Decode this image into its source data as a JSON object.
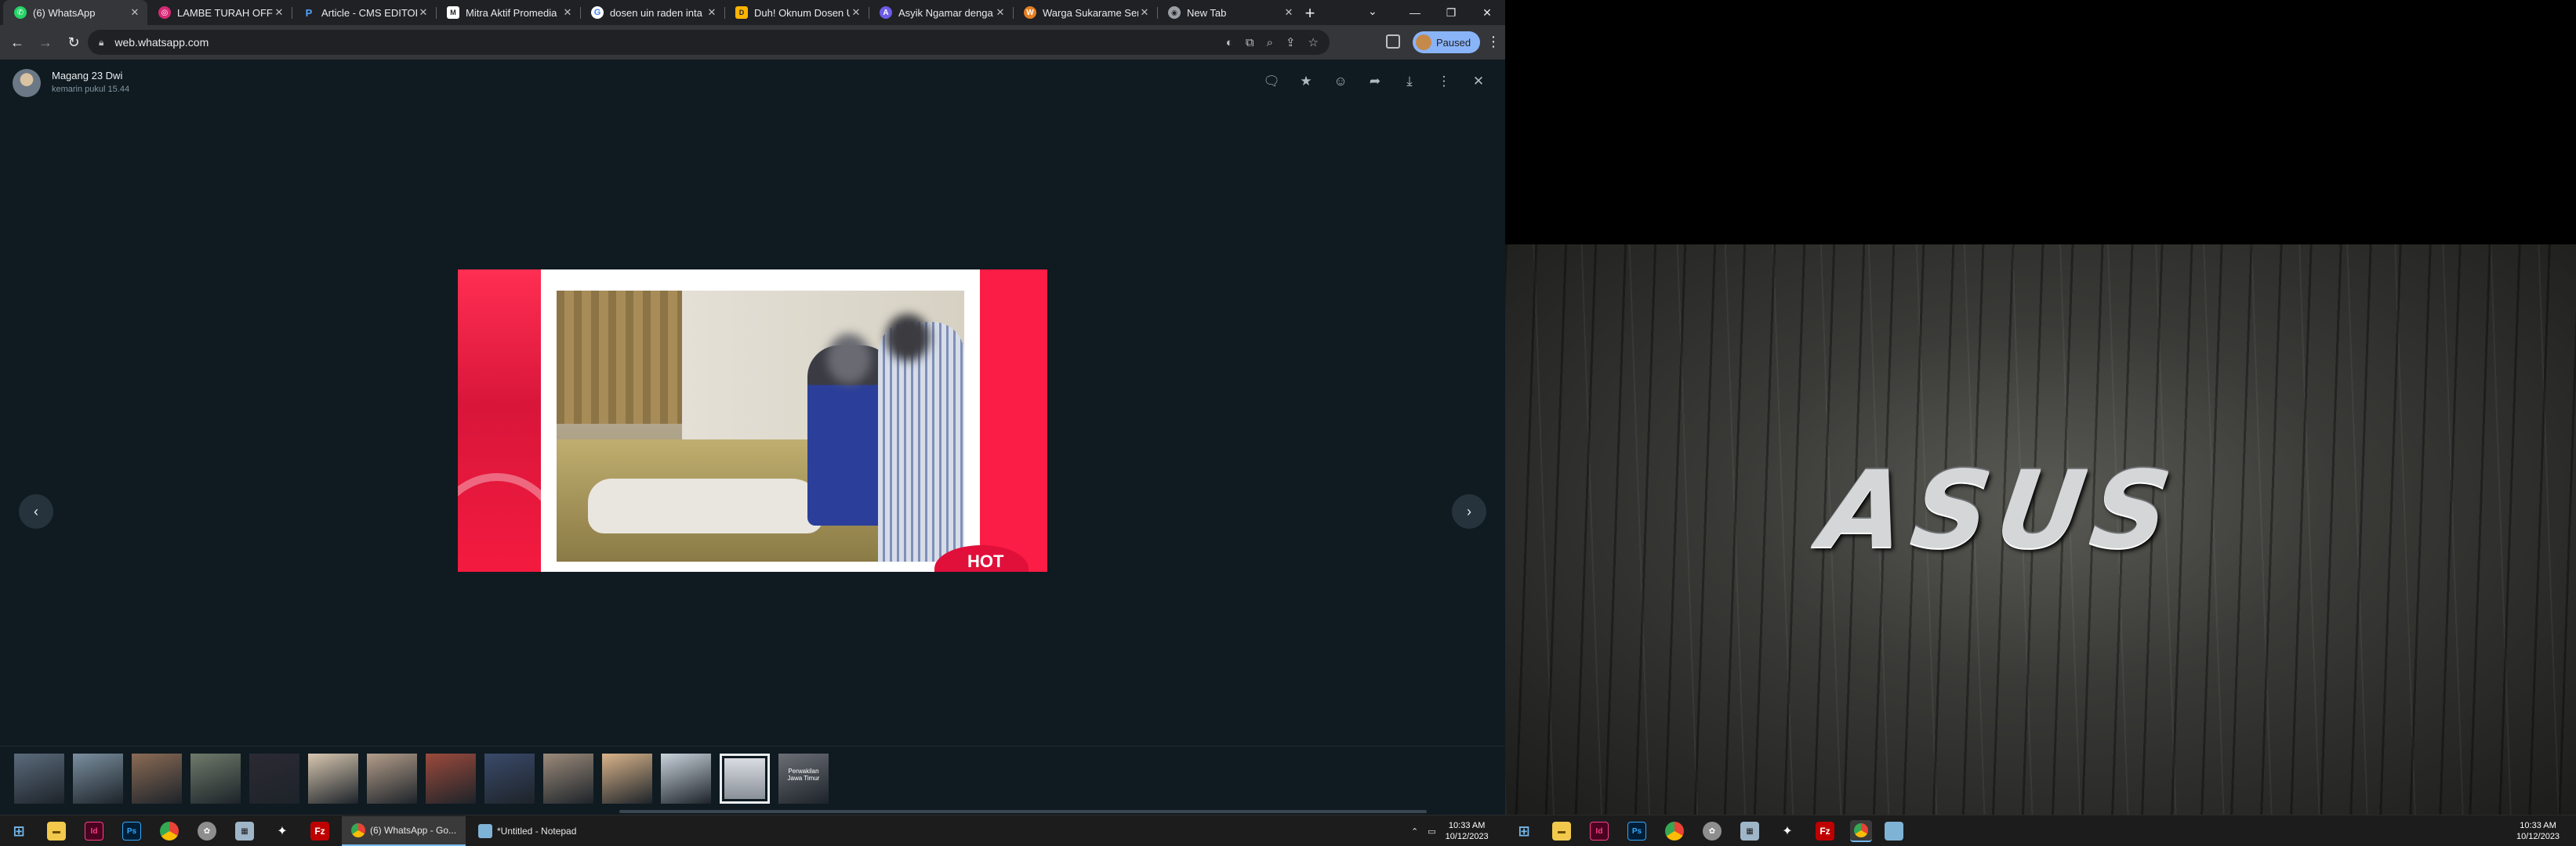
{
  "browser": {
    "tabs": [
      {
        "title": "(6) WhatsApp",
        "favicon_color": "#25d366",
        "active": true
      },
      {
        "title": "LAMBE TURAH OFFIC",
        "favicon_color": "#d62976",
        "active": false
      },
      {
        "title": "Article - CMS EDITOR",
        "favicon_color": "#1a73e8",
        "active": false
      },
      {
        "title": "Mitra Aktif Promedia",
        "favicon_color": "#ffffff",
        "active": false
      },
      {
        "title": "dosen uin raden inta",
        "favicon_color": "#ffffff",
        "active": false
      },
      {
        "title": "Duh! Oknum Dosen U",
        "favicon_color": "#ffb300",
        "active": false
      },
      {
        "title": "Asyik Ngamar denga",
        "favicon_color": "#6c5ce7",
        "active": false
      },
      {
        "title": "Warga Sukarame Sen",
        "favicon_color": "#e67e22",
        "active": false
      },
      {
        "title": "New Tab",
        "favicon_color": "#9aa0a6",
        "active": false
      }
    ],
    "new_tab_label": "+",
    "url": "web.whatsapp.com",
    "profile_label": "Paused"
  },
  "viewer": {
    "sender_name": "Magang 23 Dwi",
    "timestamp": "kemarin pukul 15.44",
    "hot_badge": "HOT",
    "thumbnail_count": 14,
    "selected_thumbnail": 12,
    "thumb_colors": [
      "#5b6b7c",
      "#7a8f9f",
      "#8b6b55",
      "#6f7a6a",
      "#2c2a33",
      "#d8c7b0",
      "#b39d8a",
      "#9c4a3c",
      "#3a4a6a",
      "#9b8a7a",
      "#d9b48a",
      "#c9d3dc",
      "#3a3a48",
      "#6b6f75"
    ],
    "last_thumb_text": "Perwakilan Jawa Timur"
  },
  "taskbar_left": {
    "apps": [
      {
        "label": "(6) WhatsApp - Go...",
        "active": true,
        "color": "#25d366"
      },
      {
        "label": "*Untitled - Notepad",
        "active": false,
        "color": "#7fb3d5"
      }
    ],
    "time": "10:33 AM",
    "date": "10/12/2023"
  },
  "taskbar_right": {
    "time": "10:33 AM",
    "date": "10/12/2023"
  },
  "wallpaper": {
    "brand": "ASUS"
  }
}
